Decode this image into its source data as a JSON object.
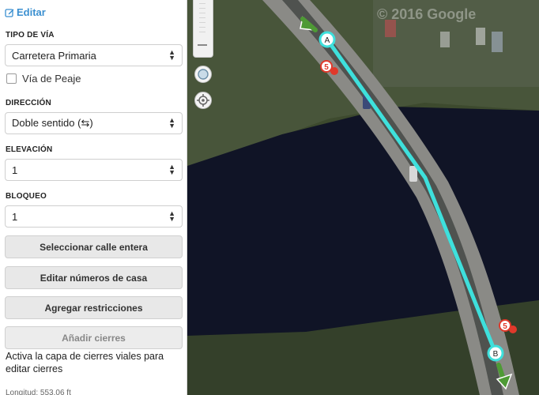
{
  "sidebar": {
    "edit_tab": "Editar",
    "road_type": {
      "label": "TIPO DE VÍA",
      "value": "Carretera Primaria"
    },
    "toll": {
      "label": "Vía de Peaje",
      "checked": false
    },
    "direction": {
      "label": "DIRECCIÓN",
      "value": "Doble sentido (⇆)"
    },
    "elevation": {
      "label": "ELEVACIÓN",
      "value": "1"
    },
    "lock": {
      "label": "BLOQUEO",
      "value": "1"
    },
    "buttons": {
      "select_street": "Seleccionar calle entera",
      "edit_house_numbers": "Editar números de casa",
      "add_restrictions": "Agregar restricciones",
      "add_closures": "Añadir cierres"
    },
    "closure_hint": "Activa la capa de cierres viales para editar cierres",
    "footer": "Longitud: 553.06 ft"
  },
  "map": {
    "watermark": "© 2016 Google",
    "node_a": "A",
    "node_b": "B",
    "speed_a": "5",
    "speed_b": "5",
    "segment_color": "#3ee0dc",
    "turn_arrow_color": "#4e9a35",
    "restriction_color": "#e0392b",
    "water_color": "#101426"
  }
}
